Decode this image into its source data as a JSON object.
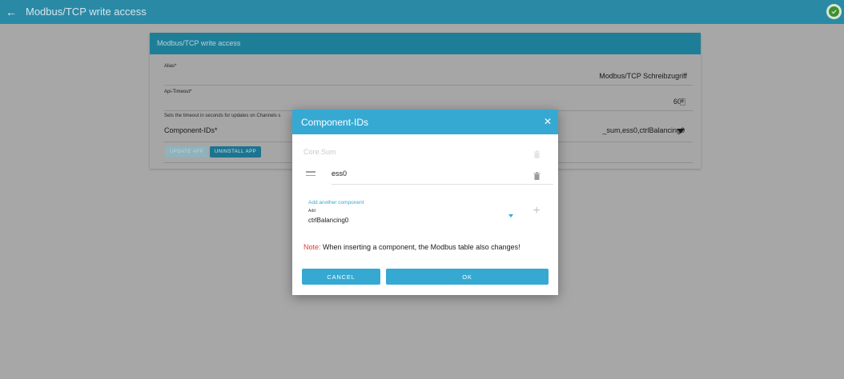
{
  "topbar": {
    "title": "Modbus/TCP write access",
    "back_icon": "arrow-left-icon",
    "status_icon": "check-circle-icon",
    "status_color": "#3f8e31"
  },
  "card": {
    "title": "Modbus/TCP write access",
    "alias_label": "Alias*",
    "alias_value": "Modbus/TCP Schreibzugriff",
    "api_timeout_label": "Api-Timeout*",
    "api_timeout_value": "60",
    "timeout_hint": "Sets the timeout in seconds for updates on Channels s",
    "component_ids_label": "Component-IDs*",
    "component_ids_value": "_sum,ess0,ctrlBalancing0",
    "update_button": "UPDATE APP",
    "uninstall_button": "UNINSTALL APP"
  },
  "modal": {
    "title": "Component-IDs",
    "close_icon": "close-icon",
    "components": [
      {
        "label": "Core.Sum",
        "disabled": true
      },
      {
        "label": "ess0",
        "disabled": false
      }
    ],
    "add_label": "Add another component",
    "add_small_label": "Add",
    "add_value": "ctrlBalancing0",
    "note_label": "Note:",
    "note_text": " When inserting a component, the Modbus table also changes!",
    "cancel_button": "CANCEL",
    "ok_button": "OK",
    "accent_color": "#36a9d3"
  }
}
